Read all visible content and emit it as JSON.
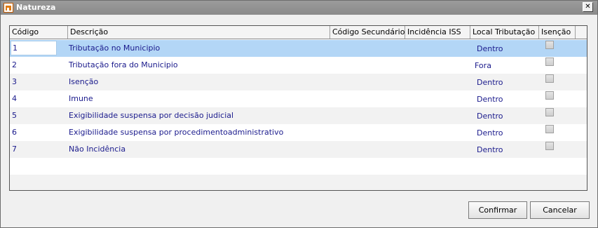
{
  "window": {
    "title": "Natureza"
  },
  "columns": {
    "codigo": "Código",
    "descricao": "Descrição",
    "codigo_secundario": "Código Secundário",
    "incidencia_iss": "Incidência ISS",
    "local_tributacao": "Local Tributação",
    "isencao": "Isenção"
  },
  "rows": [
    {
      "codigo": "1",
      "descricao": "Tributação no Municipio",
      "local": "Dentro",
      "isencao": false
    },
    {
      "codigo": "2",
      "descricao": "Tributação fora do Municipio",
      "local": "Fora",
      "isencao": false
    },
    {
      "codigo": "3",
      "descricao": "Isenção",
      "local": "Dentro",
      "isencao": false
    },
    {
      "codigo": "4",
      "descricao": "Imune",
      "local": "Dentro",
      "isencao": false
    },
    {
      "codigo": "5",
      "descricao": "Exigibilidade suspensa por decisão judicial",
      "local": "Dentro",
      "isencao": false
    },
    {
      "codigo": "6",
      "descricao": "Exigibilidade suspensa por procedimentoadministrativo",
      "local": "Dentro",
      "isencao": false
    },
    {
      "codigo": "7",
      "descricao": "Não Incidência",
      "local": "Dentro",
      "isencao": false
    }
  ],
  "buttons": {
    "confirm": "Confirmar",
    "cancel": "Cancelar"
  },
  "colors": {
    "selected_row": "#b3d6f6",
    "text": "#1a1a8c",
    "titlebar": "#8f8f8f"
  }
}
